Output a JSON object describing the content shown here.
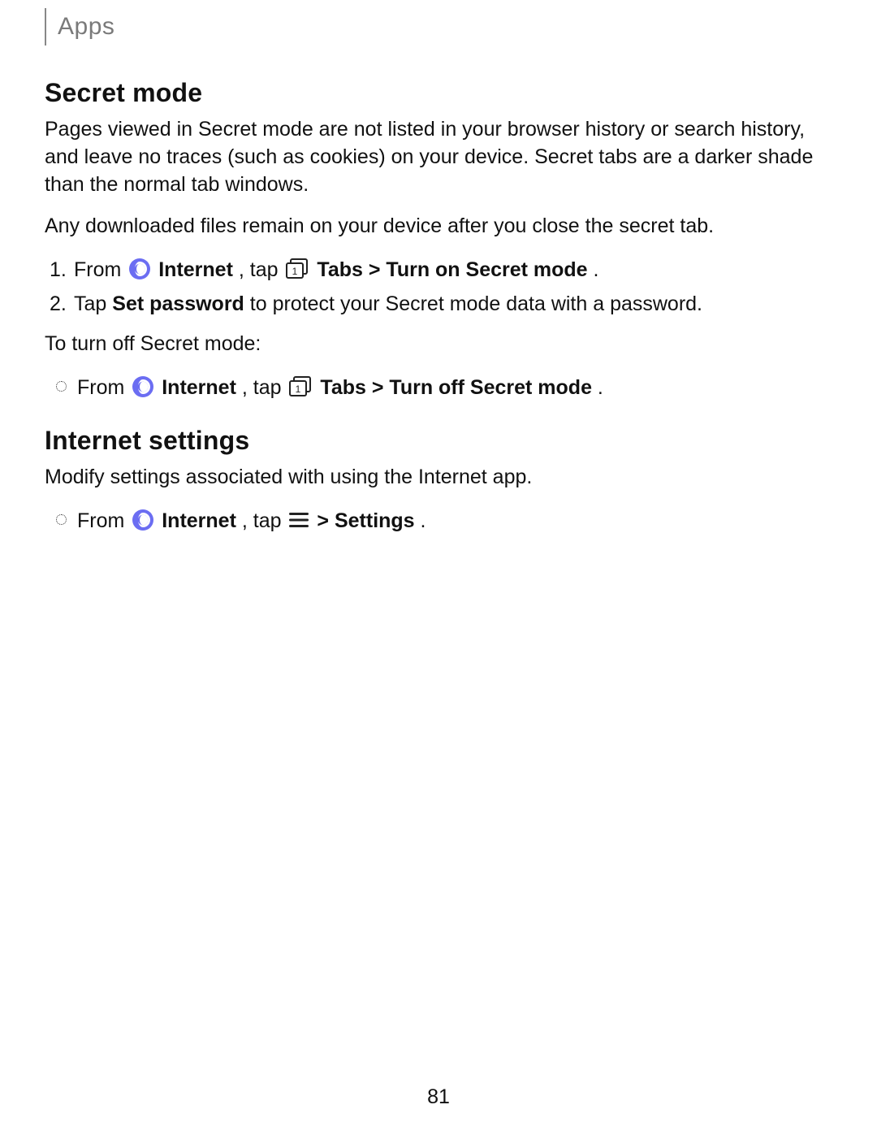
{
  "header": {
    "label": "Apps"
  },
  "section1": {
    "title": "Secret mode",
    "para1": "Pages viewed in Secret mode are not listed in your browser history or search history, and leave no traces (such as cookies) on your device. Secret tabs are a darker shade than the normal tab windows.",
    "para2": "Any downloaded files remain on your device after you close the secret tab.",
    "step1_num": "1.",
    "step1_a": "From ",
    "step1_internet": " Internet",
    "step1_b": ", tap ",
    "step1_tabs": " Tabs > Turn on Secret mode",
    "step1_c": ".",
    "step2_num": "2.",
    "step2_a": "Tap ",
    "step2_setpw": "Set password",
    "step2_b": " to protect your Secret mode data with a password.",
    "para3": "To turn off Secret mode:",
    "off_a": "From ",
    "off_internet": " Internet",
    "off_b": ", tap ",
    "off_tabs": " Tabs > Turn off Secret mode",
    "off_c": "."
  },
  "section2": {
    "title": "Internet settings",
    "para1": "Modify settings associated with using the Internet app.",
    "item_a": "From ",
    "item_internet": " Internet",
    "item_b": ", tap ",
    "item_settings": " > Settings",
    "item_c": "."
  },
  "page_number": "81"
}
